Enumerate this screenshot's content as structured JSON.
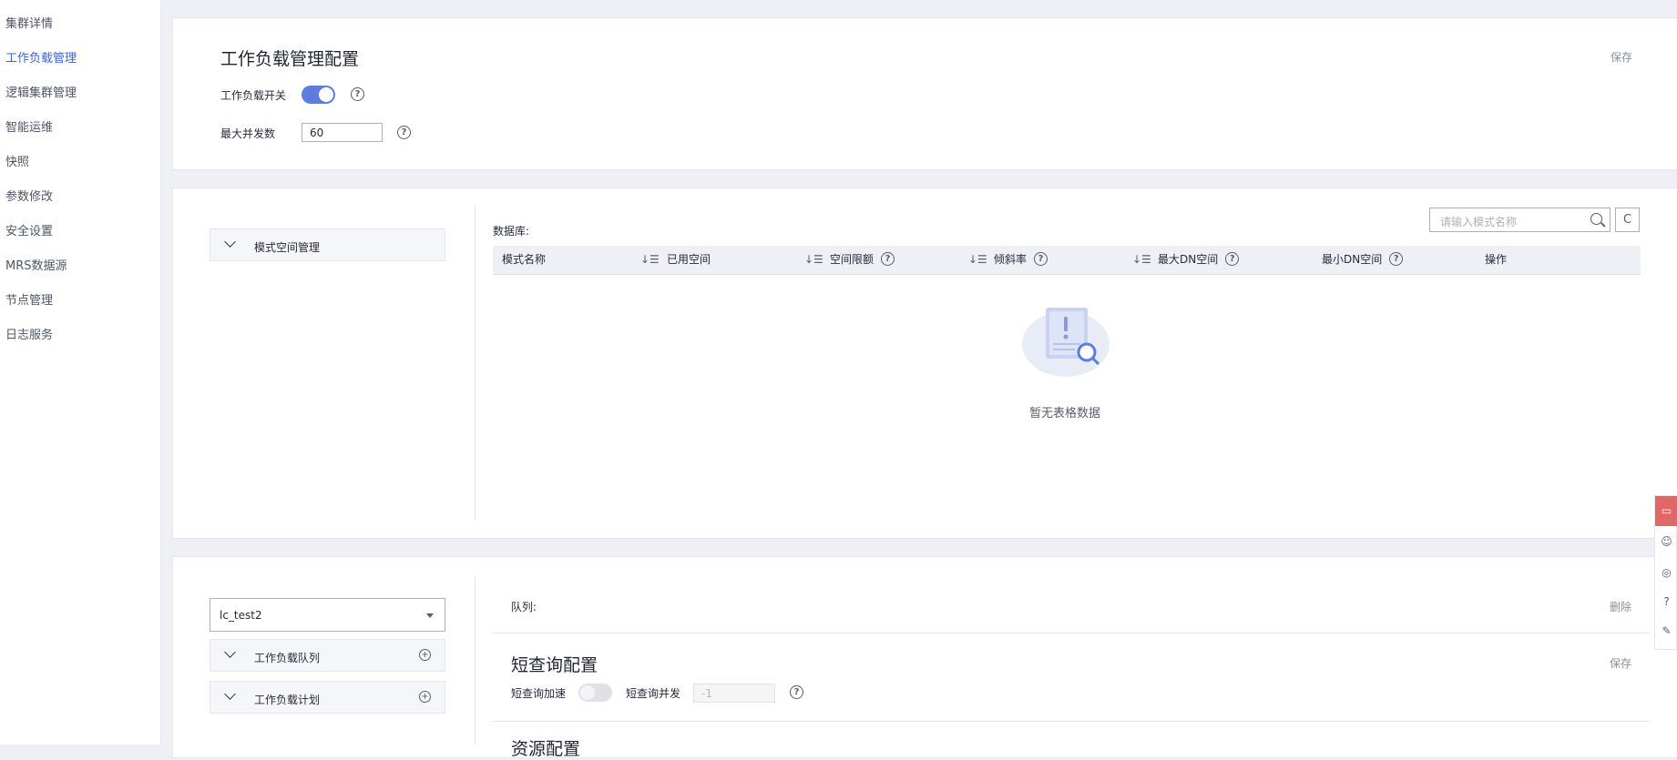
{
  "sidebar": {
    "items": [
      {
        "label": "集群详情"
      },
      {
        "label": "工作负载管理"
      },
      {
        "label": "逻辑集群管理"
      },
      {
        "label": "智能运维"
      },
      {
        "label": "快照"
      },
      {
        "label": "参数修改"
      },
      {
        "label": "安全设置"
      },
      {
        "label": "MRS数据源"
      },
      {
        "label": "节点管理"
      },
      {
        "label": "日志服务"
      }
    ],
    "active_index": 1
  },
  "wlm_config": {
    "title": "工作负载管理配置",
    "save_label": "保存",
    "switch_label": "工作负载开关",
    "switch_on": true,
    "max_concurrency_label": "最大并发数",
    "max_concurrency_value": "60"
  },
  "schema_space": {
    "collapse_label": "模式空间管理",
    "database_label": "数据库:",
    "search_placeholder": "请输入模式名称",
    "columns": [
      {
        "label": "模式名称",
        "help": false
      },
      {
        "label": "已用空间",
        "help": false
      },
      {
        "label": "空间限额",
        "help": true
      },
      {
        "label": "倾斜率",
        "help": true
      },
      {
        "label": "最大DN空间",
        "help": true
      },
      {
        "label": "最小DN空间",
        "help": true
      },
      {
        "label": "操作",
        "help": false
      }
    ],
    "empty_text": "暂无表格数据"
  },
  "queue_panel": {
    "selected_cluster": "lc_test2",
    "queue_collapse_label": "工作负载队列",
    "plan_collapse_label": "工作负载计划",
    "queue_label": "队列:",
    "delete_label": "删除",
    "short_query_title": "短查询配置",
    "short_query_save_label": "保存",
    "short_query_accel_label": "短查询加速",
    "short_query_accel_on": false,
    "short_query_concurrency_label": "短查询并发",
    "short_query_concurrency_value": "-1",
    "next_section_title": "资源配置"
  },
  "icons": {
    "help": "?",
    "refresh": "C",
    "plus": "+"
  },
  "colors": {
    "accent": "#5e7ce0",
    "active_nav": "#3d63d6",
    "feedback_red": "#e06866",
    "page_bg": "#eef0f5"
  }
}
